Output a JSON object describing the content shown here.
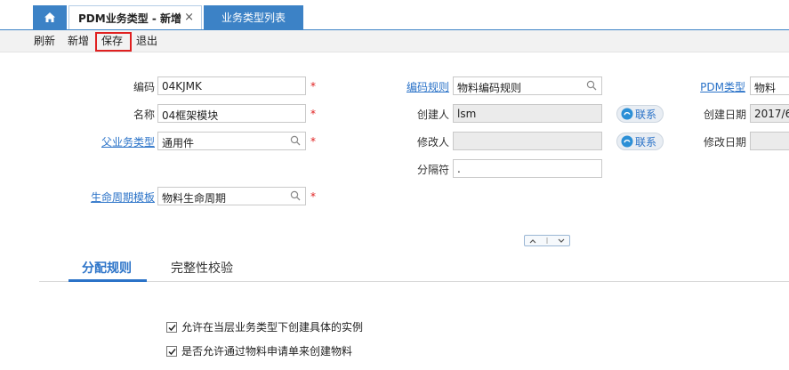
{
  "tabs": {
    "home_icon": "home-icon",
    "active_label": "PDM业务类型 - 新增",
    "close_glyph": "×",
    "inactive_label": "业务类型列表"
  },
  "toolbar": {
    "refresh": "刷新",
    "add": "新增",
    "save": "保存",
    "exit": "退出"
  },
  "form": {
    "code": {
      "label": "编码",
      "value": "04KJMK",
      "required": "*"
    },
    "name": {
      "label": "名称",
      "value": "04框架模块",
      "required": "*"
    },
    "parent_type": {
      "label": "父业务类型",
      "value": "通用件",
      "required": "*"
    },
    "lifecycle_template": {
      "label": "生命周期模板",
      "value": "物料生命周期",
      "required": "*"
    },
    "code_rule": {
      "label": "编码规则",
      "value": "物料编码规则"
    },
    "creator": {
      "label": "创建人",
      "value": "lsm",
      "contact": "联系"
    },
    "modifier": {
      "label": "修改人",
      "value": "",
      "contact": "联系"
    },
    "separator": {
      "label": "分隔符",
      "value": "."
    },
    "pdm_type": {
      "label": "PDM类型",
      "value": "物料"
    },
    "create_date": {
      "label": "创建日期",
      "value": "2017/6"
    },
    "modify_date": {
      "label": "修改日期",
      "value": ""
    }
  },
  "subtabs": {
    "assign_rules": "分配规则",
    "integrity_check": "完整性校验"
  },
  "options": [
    {
      "label": "允许在当层业务类型下创建具体的实例",
      "checked": true
    },
    {
      "label": "是否允许通过物料申请单来创建物料",
      "checked": true
    }
  ],
  "colors": {
    "accent": "#3c82c6",
    "link": "#2b73c8",
    "required": "#e02020"
  }
}
